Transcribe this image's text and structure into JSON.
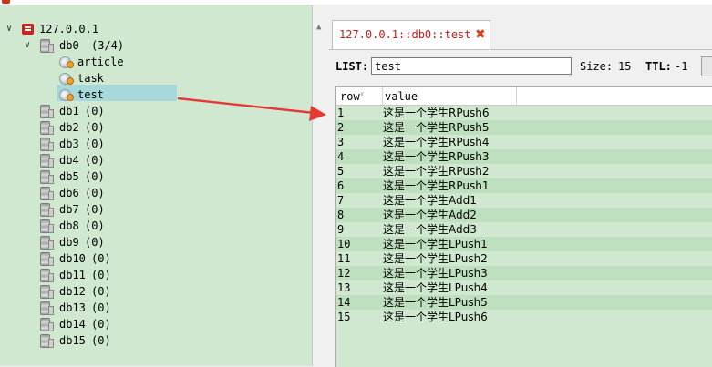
{
  "server": {
    "label": "127.0.0.1",
    "expanded": true
  },
  "databases": [
    {
      "name": "db0",
      "count": "(3/4)",
      "expanded": true,
      "keys": [
        "article",
        "task",
        "test"
      ],
      "selected_key": "test"
    },
    {
      "name": "db1",
      "count": "(0)"
    },
    {
      "name": "db2",
      "count": "(0)"
    },
    {
      "name": "db3",
      "count": "(0)"
    },
    {
      "name": "db4",
      "count": "(0)"
    },
    {
      "name": "db5",
      "count": "(0)"
    },
    {
      "name": "db6",
      "count": "(0)"
    },
    {
      "name": "db7",
      "count": "(0)"
    },
    {
      "name": "db8",
      "count": "(0)"
    },
    {
      "name": "db9",
      "count": "(0)"
    },
    {
      "name": "db10",
      "count": "(0)"
    },
    {
      "name": "db11",
      "count": "(0)"
    },
    {
      "name": "db12",
      "count": "(0)"
    },
    {
      "name": "db13",
      "count": "(0)"
    },
    {
      "name": "db14",
      "count": "(0)"
    },
    {
      "name": "db15",
      "count": "(0)"
    }
  ],
  "tab": {
    "title": "127.0.0.1::db0::test"
  },
  "key_bar": {
    "type_label": "LIST:",
    "key_value": "test",
    "size_label": "Size:",
    "size_value": "15",
    "ttl_label": "TTL:",
    "ttl_value": "-1"
  },
  "table": {
    "headers": [
      "row",
      "value"
    ],
    "rows": [
      [
        "1",
        "这是一个学生RPush6"
      ],
      [
        "2",
        "这是一个学生RPush5"
      ],
      [
        "3",
        "这是一个学生RPush4"
      ],
      [
        "4",
        "这是一个学生RPush3"
      ],
      [
        "5",
        "这是一个学生RPush2"
      ],
      [
        "6",
        "这是一个学生RPush1"
      ],
      [
        "7",
        "这是一个学生Add1"
      ],
      [
        "8",
        "这是一个学生Add2"
      ],
      [
        "9",
        "这是一个学生Add3"
      ],
      [
        "10",
        "这是一个学生LPush1"
      ],
      [
        "11",
        "这是一个学生LPush2"
      ],
      [
        "12",
        "这是一个学生LPush3"
      ],
      [
        "13",
        "这是一个学生LPush4"
      ],
      [
        "14",
        "这是一个学生LPush5"
      ],
      [
        "15",
        "这是一个学生LPush6"
      ]
    ]
  },
  "colors": {
    "panel_green": "#cfe8cf",
    "selection": "#a6d8dc",
    "tab_text": "#c02020",
    "arrow": "#e53935"
  },
  "icons": {
    "server": "server-icon",
    "database": "database-icon",
    "key": "key-icon",
    "close": "close-icon"
  }
}
